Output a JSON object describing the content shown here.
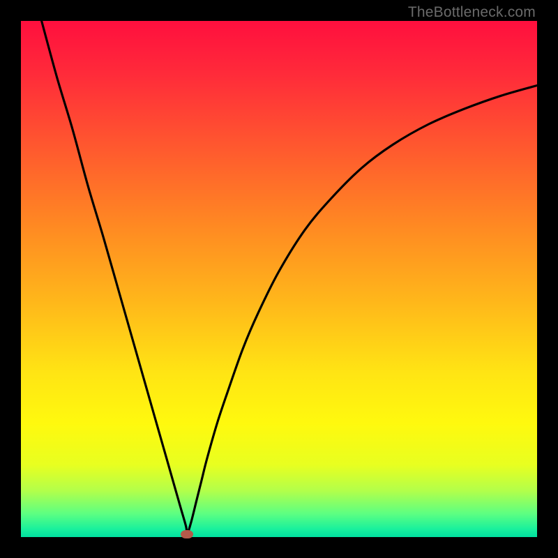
{
  "watermark": "TheBottleneck.com",
  "colors": {
    "frame": "#000000",
    "curve": "#000000",
    "marker": "#b45a4a",
    "gradient_stops": [
      {
        "pos": 0.0,
        "color": "#ff0f3e"
      },
      {
        "pos": 0.1,
        "color": "#ff2a3a"
      },
      {
        "pos": 0.25,
        "color": "#ff5a2e"
      },
      {
        "pos": 0.4,
        "color": "#ff8a22"
      },
      {
        "pos": 0.55,
        "color": "#ffb91a"
      },
      {
        "pos": 0.68,
        "color": "#ffe414"
      },
      {
        "pos": 0.78,
        "color": "#fff90e"
      },
      {
        "pos": 0.86,
        "color": "#e8ff20"
      },
      {
        "pos": 0.91,
        "color": "#b3ff4a"
      },
      {
        "pos": 0.955,
        "color": "#5cff82"
      },
      {
        "pos": 0.985,
        "color": "#18f09d"
      },
      {
        "pos": 1.0,
        "color": "#00e0a0"
      }
    ]
  },
  "chart_data": {
    "type": "line",
    "title": "",
    "xlabel": "",
    "ylabel": "",
    "xlim": [
      0,
      100
    ],
    "ylim": [
      0,
      100
    ],
    "legend": false,
    "grid": false,
    "marker": {
      "x": 32.2,
      "y": 0.5
    },
    "series": [
      {
        "name": "bottleneck-curve",
        "x": [
          4,
          7,
          10,
          13,
          16,
          19,
          22,
          25,
          28,
          30,
          31,
          32,
          32.2,
          33,
          34,
          35,
          36,
          38,
          40,
          43,
          46,
          50,
          55,
          60,
          66,
          72,
          79,
          86,
          93,
          100
        ],
        "y": [
          100,
          89,
          79,
          68,
          58,
          47.5,
          37,
          26.5,
          16,
          9,
          5.5,
          2,
          0.5,
          3,
          7,
          11,
          15,
          22,
          28,
          36.5,
          43.5,
          51.5,
          59.5,
          65.5,
          71.5,
          76,
          80,
          83,
          85.5,
          87.5
        ]
      }
    ]
  }
}
